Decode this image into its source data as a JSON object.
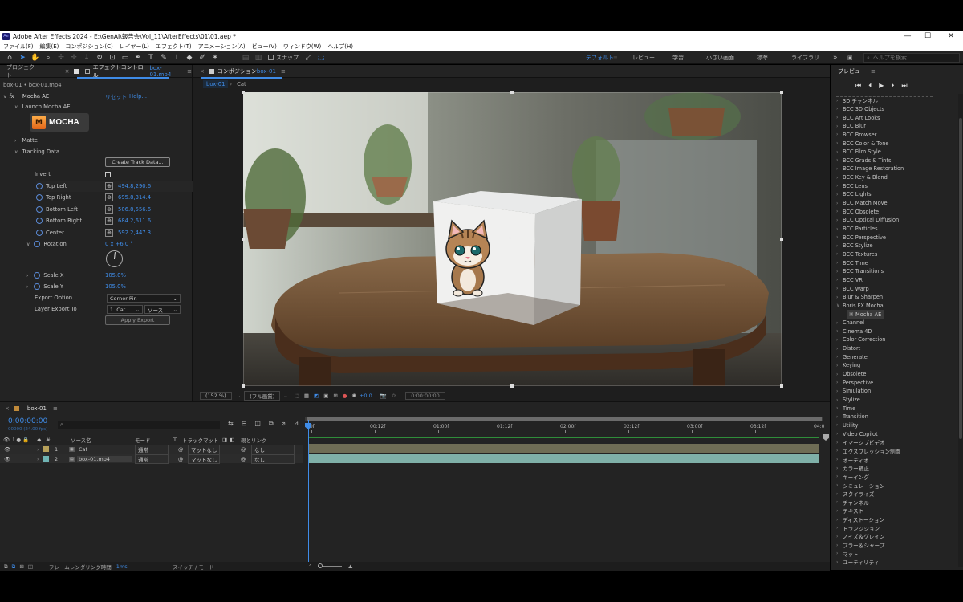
{
  "window": {
    "title": "Adobe After Effects 2024 - E:\\GenAI\\報告会\\Vol_11\\AfterEffects\\01\\01.aep *",
    "app_icon": "Ae"
  },
  "menu": [
    "ファイル(F)",
    "編集(E)",
    "コンポジション(C)",
    "レイヤー(L)",
    "エフェクト(T)",
    "アニメーション(A)",
    "ビュー(V)",
    "ウィンドウ(W)",
    "ヘルプ(H)"
  ],
  "toolbar": {
    "snap_label": "スナップ",
    "workspaces": [
      "デフォルト",
      "レビュー",
      "学習",
      "小さい画面",
      "標準",
      "ライブラリ"
    ],
    "search_placeholder": "ヘルプを検索"
  },
  "left_panel": {
    "tab_project": "プロジェクト",
    "tab_effect_controls": "エフェクトコントロール",
    "tab_effect_layer": "box-01.mp4",
    "breadcrumb": "box-01 • box-01.mp4",
    "effect_name": "Mocha AE",
    "reset_label": "リセット",
    "help_label": "Help...",
    "launch_label": "Launch Mocha AE",
    "mocha_logo_text": "MOCHA",
    "matte_label": "Matte",
    "tracking_label": "Tracking Data",
    "create_track_label": "Create Track Data...",
    "invert_label": "Invert",
    "params": [
      {
        "label": "Top Left",
        "value": "494.8,290.6"
      },
      {
        "label": "Top Right",
        "value": "695.8,314.4"
      },
      {
        "label": "Bottom Left",
        "value": "506.8,556.6"
      },
      {
        "label": "Bottom Right",
        "value": "684.2,611.6"
      },
      {
        "label": "Center",
        "value": "592.2,447.3"
      }
    ],
    "rotation_label": "Rotation",
    "rotation_value": "0 x +6.0 °",
    "scale_x_label": "Scale X",
    "scale_x_value": "105.0%",
    "scale_y_label": "Scale Y",
    "scale_y_value": "105.0%",
    "export_option_label": "Export Option",
    "export_option_value": "Corner Pin",
    "layer_export_label": "Layer Export To",
    "layer_export_value": "1. Cat",
    "layer_export_source": "ソース",
    "apply_export_label": "Apply Export"
  },
  "comp_panel": {
    "tab_label": "コンポジション",
    "comp_name": "box-01",
    "breadcrumb_comp": "box-01",
    "breadcrumb_layer": "Cat",
    "zoom": "(152 %)",
    "quality": "(フル画質)",
    "exposure": "+0.0",
    "timecode": "0:00:00:00"
  },
  "right_panel": {
    "title": "プレビュー",
    "effects": [
      {
        "label": "3D チャンネル",
        "open": false
      },
      {
        "label": "BCC 3D Objects",
        "open": false
      },
      {
        "label": "BCC Art Looks",
        "open": false
      },
      {
        "label": "BCC Blur",
        "open": false
      },
      {
        "label": "BCC Browser",
        "open": false
      },
      {
        "label": "BCC Color & Tone",
        "open": false
      },
      {
        "label": "BCC Film Style",
        "open": false
      },
      {
        "label": "BCC Grads & Tints",
        "open": false
      },
      {
        "label": "BCC Image Restoration",
        "open": false
      },
      {
        "label": "BCC Key & Blend",
        "open": false
      },
      {
        "label": "BCC Lens",
        "open": false
      },
      {
        "label": "BCC Lights",
        "open": false
      },
      {
        "label": "BCC Match Move",
        "open": false
      },
      {
        "label": "BCC Obsolete",
        "open": false
      },
      {
        "label": "BCC Optical Diffusion",
        "open": false
      },
      {
        "label": "BCC Particles",
        "open": false
      },
      {
        "label": "BCC Perspective",
        "open": false
      },
      {
        "label": "BCC Stylize",
        "open": false
      },
      {
        "label": "BCC Textures",
        "open": false
      },
      {
        "label": "BCC Time",
        "open": false
      },
      {
        "label": "BCC Transitions",
        "open": false
      },
      {
        "label": "BCC VR",
        "open": false
      },
      {
        "label": "BCC Warp",
        "open": false
      },
      {
        "label": "Blur & Sharpen",
        "open": false
      },
      {
        "label": "Boris FX Mocha",
        "open": true
      },
      {
        "label": "Mocha AE",
        "open": false,
        "child": true
      },
      {
        "label": "Channel",
        "open": false
      },
      {
        "label": "Cinema 4D",
        "open": false
      },
      {
        "label": "Color Correction",
        "open": false
      },
      {
        "label": "Distort",
        "open": false
      },
      {
        "label": "Generate",
        "open": false
      },
      {
        "label": "Keying",
        "open": false
      },
      {
        "label": "Obsolete",
        "open": false
      },
      {
        "label": "Perspective",
        "open": false
      },
      {
        "label": "Simulation",
        "open": false
      },
      {
        "label": "Stylize",
        "open": false
      },
      {
        "label": "Time",
        "open": false
      },
      {
        "label": "Transition",
        "open": false
      },
      {
        "label": "Utility",
        "open": false
      },
      {
        "label": "Video Copilot",
        "open": false
      },
      {
        "label": "イマーシブビデオ",
        "open": false
      },
      {
        "label": "エクスプレッション制御",
        "open": false
      },
      {
        "label": "オーディオ",
        "open": false
      },
      {
        "label": "カラー補正",
        "open": false
      },
      {
        "label": "キーイング",
        "open": false
      },
      {
        "label": "シミュレーション",
        "open": false
      },
      {
        "label": "スタイライズ",
        "open": false
      },
      {
        "label": "チャンネル",
        "open": false
      },
      {
        "label": "テキスト",
        "open": false
      },
      {
        "label": "ディストーション",
        "open": false
      },
      {
        "label": "トランジション",
        "open": false
      },
      {
        "label": "ノイズ＆グレイン",
        "open": false
      },
      {
        "label": "ブラー＆シャープ",
        "open": false
      },
      {
        "label": "マット",
        "open": false
      },
      {
        "label": "ユーティリティ",
        "open": false
      }
    ]
  },
  "timeline": {
    "tab_label": "box-01",
    "timecode": "0:00:00:00",
    "frame_info": "00000 (24.00 fps)",
    "search_placeholder": "",
    "col_source": "ソース名",
    "col_mode": "モード",
    "col_t": "T",
    "col_trackmatte": "トラックマット",
    "col_parent": "親とリンク",
    "ruler": [
      "00f",
      "00:12f",
      "01:00f",
      "01:12f",
      "02:00f",
      "02:12f",
      "03:00f",
      "03:12f",
      "04:0"
    ],
    "layers": [
      {
        "num": "1",
        "name": "Cat",
        "mode": "通常",
        "matte": "マットなし",
        "parent": "なし",
        "color": "#b7a15a",
        "bar_color": "#6f6d55"
      },
      {
        "num": "2",
        "name": "box-01.mp4",
        "mode": "通常",
        "matte": "マットなし",
        "parent": "なし",
        "color": "#6fb3b3",
        "bar_color": "#7fb0a8"
      }
    ],
    "status_render_label": "フレームレンダリング時間",
    "status_render_value": "1ms",
    "status_switch": "スイッチ / モード"
  }
}
